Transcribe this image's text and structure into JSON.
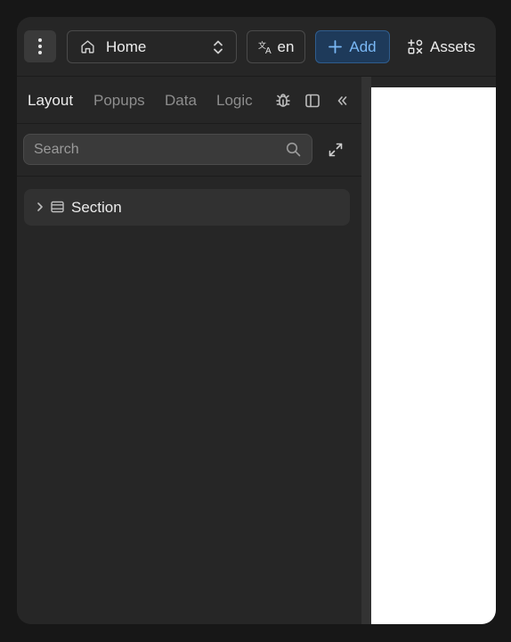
{
  "toolbar": {
    "page_select": {
      "value": "Home",
      "icon": "home-icon"
    },
    "language": {
      "label": "en",
      "icon": "translate-icon"
    },
    "add": {
      "label": "Add",
      "icon": "plus-icon",
      "color": "#7ab8f5"
    },
    "assets": {
      "label": "Assets",
      "icon": "assets-icon"
    }
  },
  "panel": {
    "tabs": [
      {
        "label": "Layout",
        "active": true
      },
      {
        "label": "Popups",
        "active": false
      },
      {
        "label": "Data",
        "active": false
      },
      {
        "label": "Logic",
        "active": false
      }
    ],
    "icons": [
      "bug-icon",
      "panel-layout-icon",
      "collapse-icon"
    ],
    "search": {
      "placeholder": "Search",
      "value": ""
    },
    "tree": [
      {
        "label": "Section",
        "icon": "section-icon",
        "collapsed": true
      }
    ]
  }
}
